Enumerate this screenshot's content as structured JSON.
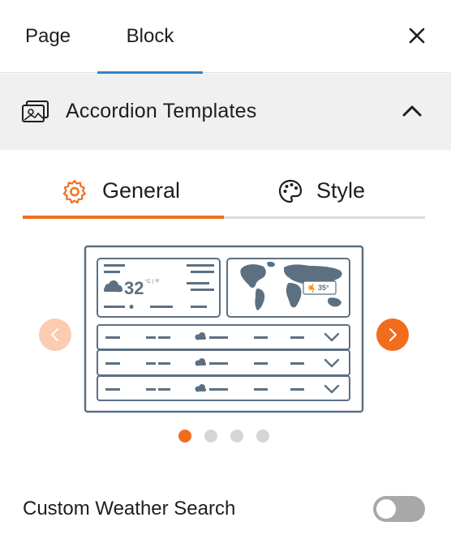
{
  "tabs": {
    "page_label": "Page",
    "block_label": "Block",
    "active": "Block"
  },
  "panel": {
    "title": "Accordion Templates",
    "expanded": true,
    "icon": "images-icon"
  },
  "subtabs": {
    "general_label": "General",
    "style_label": "Style",
    "active": "General"
  },
  "template_preview": {
    "temperature": "32",
    "units": "°C | °F",
    "map_temperature": "35°"
  },
  "carousel": {
    "slide_count": 4,
    "active_index": 0
  },
  "settings": {
    "custom_weather_search_label": "Custom Weather Search",
    "custom_weather_search_enabled": false
  },
  "colors": {
    "accent": "#f26c1e",
    "accent_light": "#fccbb1",
    "tab_underline": "#3582c4",
    "preview_slate": "#5c7082",
    "header_bg": "#f0f0f0"
  }
}
